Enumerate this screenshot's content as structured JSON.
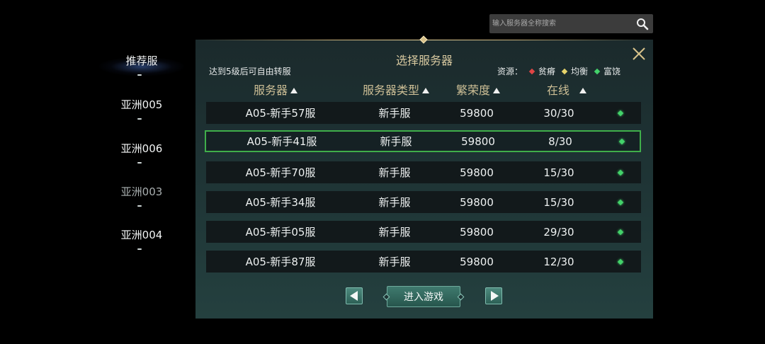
{
  "search": {
    "placeholder": "输入服务器全称搜索",
    "icon": "search-icon"
  },
  "regions": [
    {
      "label": "推荐服",
      "state": "active"
    },
    {
      "label": "亚洲005",
      "state": "normal"
    },
    {
      "label": "亚洲006",
      "state": "normal"
    },
    {
      "label": "亚洲003",
      "state": "dim"
    },
    {
      "label": "亚洲004",
      "state": "normal"
    }
  ],
  "panel": {
    "title": "选择服务器",
    "transfer_note": "达到5级后可自由转服",
    "legend": {
      "label": "资源：",
      "items": [
        {
          "label": "贫瘠",
          "color": "#e04545"
        },
        {
          "label": "均衡",
          "color": "#e6d36a"
        },
        {
          "label": "富饶",
          "color": "#43d26a"
        }
      ]
    },
    "headers": {
      "server": "服务器",
      "type": "服务器类型",
      "prosperity": "繁荣度",
      "online": "在线"
    },
    "rows": [
      {
        "server": "A05-新手57服",
        "type": "新手服",
        "prosperity": "59800",
        "online": "30/30"
      },
      {
        "server": "A05-新手41服",
        "type": "新手服",
        "prosperity": "59800",
        "online": "8/30"
      },
      {
        "server": "A05-新手70服",
        "type": "新手服",
        "prosperity": "59800",
        "online": "15/30"
      },
      {
        "server": "A05-新手34服",
        "type": "新手服",
        "prosperity": "59800",
        "online": "15/30"
      },
      {
        "server": "A05-新手05服",
        "type": "新手服",
        "prosperity": "59800",
        "online": "29/30"
      },
      {
        "server": "A05-新手87服",
        "type": "新手服",
        "prosperity": "59800",
        "online": "12/30"
      }
    ],
    "selected_row": "A05-新手41服",
    "enter_label": "进入游戏"
  },
  "colors": {
    "accent_gold": "#cdbf96",
    "selected_border": "#3fae4a",
    "rich_gem": "#43d26a"
  }
}
